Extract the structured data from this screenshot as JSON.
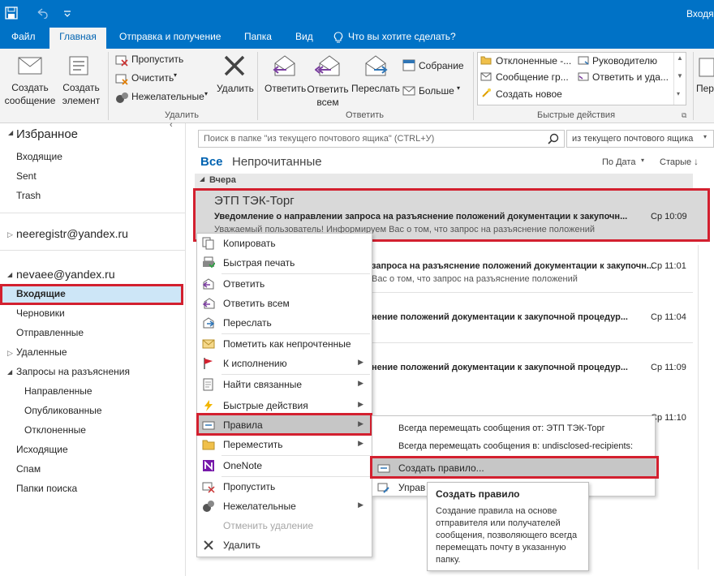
{
  "titlebar": {
    "title_right": "Входящ"
  },
  "tabs": [
    "Файл",
    "Главная",
    "Отправка и получение",
    "Папка",
    "Вид"
  ],
  "tell_me": "Что вы хотите сделать?",
  "ribbon": {
    "new_mail": "Создать\nсообщение",
    "new_item": "Создать\nэлемент",
    "ignore": "Пропустить",
    "clean": "Очистить",
    "junk": "Нежелательные",
    "delete": "Удалить",
    "group_delete": "Удалить",
    "reply": "Ответить",
    "reply_all": "Ответить\nвсем",
    "forward": "Переслать",
    "meeting": "Собрание",
    "more": "Больше",
    "group_reply": "Ответить",
    "qs": [
      "Отклоненные -...",
      "Руководителю",
      "Сообщение гр...",
      "Ответить и уда...",
      "Создать новое"
    ],
    "group_quick": "Быстрые действия",
    "per": "Пер"
  },
  "nav": {
    "favorites": "Избранное",
    "fav_items": [
      "Входящие",
      "Sent",
      "Trash"
    ],
    "account1": "neeregistr@yandex.ru",
    "account2": "nevaee@yandex.ru",
    "folders": [
      "Входящие",
      "Черновики",
      "Отправленные",
      "Удаленные",
      "Запросы на разъяснения",
      "Направленные",
      "Опубликованные",
      "Отклоненные",
      "Исходящие",
      "Спам",
      "Папки поиска"
    ]
  },
  "search": {
    "placeholder": "Поиск в папке \"из текущего почтового ящика\" (CTRL+У)",
    "scope": "из текущего почтового ящика"
  },
  "filters": {
    "all": "Все",
    "unread": "Непрочитанные",
    "sort_by": "По Дата",
    "order": "Старые"
  },
  "list": {
    "group": "Вчера",
    "selected": {
      "sender": "ЭТП ТЭК-Торг",
      "subject": "Уведомление о направлении запроса на разъяснение положений документации к закупочн...",
      "time": "Ср 10:09",
      "preview": "Уважаемый пользователь! Информируем Вас о том, что запрос на разъяснение положений"
    },
    "rows": [
      {
        "subject": "запроса на разъяснение положений документации к закупочн...",
        "time": "Ср 11:01",
        "preview": "Вас о том, что запрос на разъяснение положений"
      },
      {
        "subject": "нение положений документации к закупочной процедур...",
        "time": "Ср 11:04",
        "preview": ""
      },
      {
        "subject": "нение положений документации к закупочной процедур...",
        "time": "Ср 11:09",
        "preview": ""
      },
      {
        "subject": "",
        "time": "Ср 11:10",
        "preview": ""
      }
    ]
  },
  "context_menu": [
    "Копировать",
    "Быстрая печать",
    "Ответить",
    "Ответить всем",
    "Переслать",
    "Пометить как непрочтенные",
    "К исполнению",
    "Найти связанные",
    "Быстрые действия",
    "Правила",
    "Переместить",
    "OneNote",
    "Пропустить",
    "Нежелательные",
    "Отменить удаление",
    "Удалить"
  ],
  "submenu": [
    "Всегда перемещать сообщения от: ЭТП ТЭК-Торг",
    "Всегда перемещать сообщения в: undisclosed-recipients:",
    "Создать правило...",
    "Управ"
  ],
  "tooltip": {
    "title": "Создать правило",
    "body": "Создание правила на основе отправителя или получателей сообщения, позволяющего всегда перемещать почту в указанную папку."
  },
  "colors": {
    "accent": "#0072c6",
    "highlight_red": "#d3202f"
  }
}
